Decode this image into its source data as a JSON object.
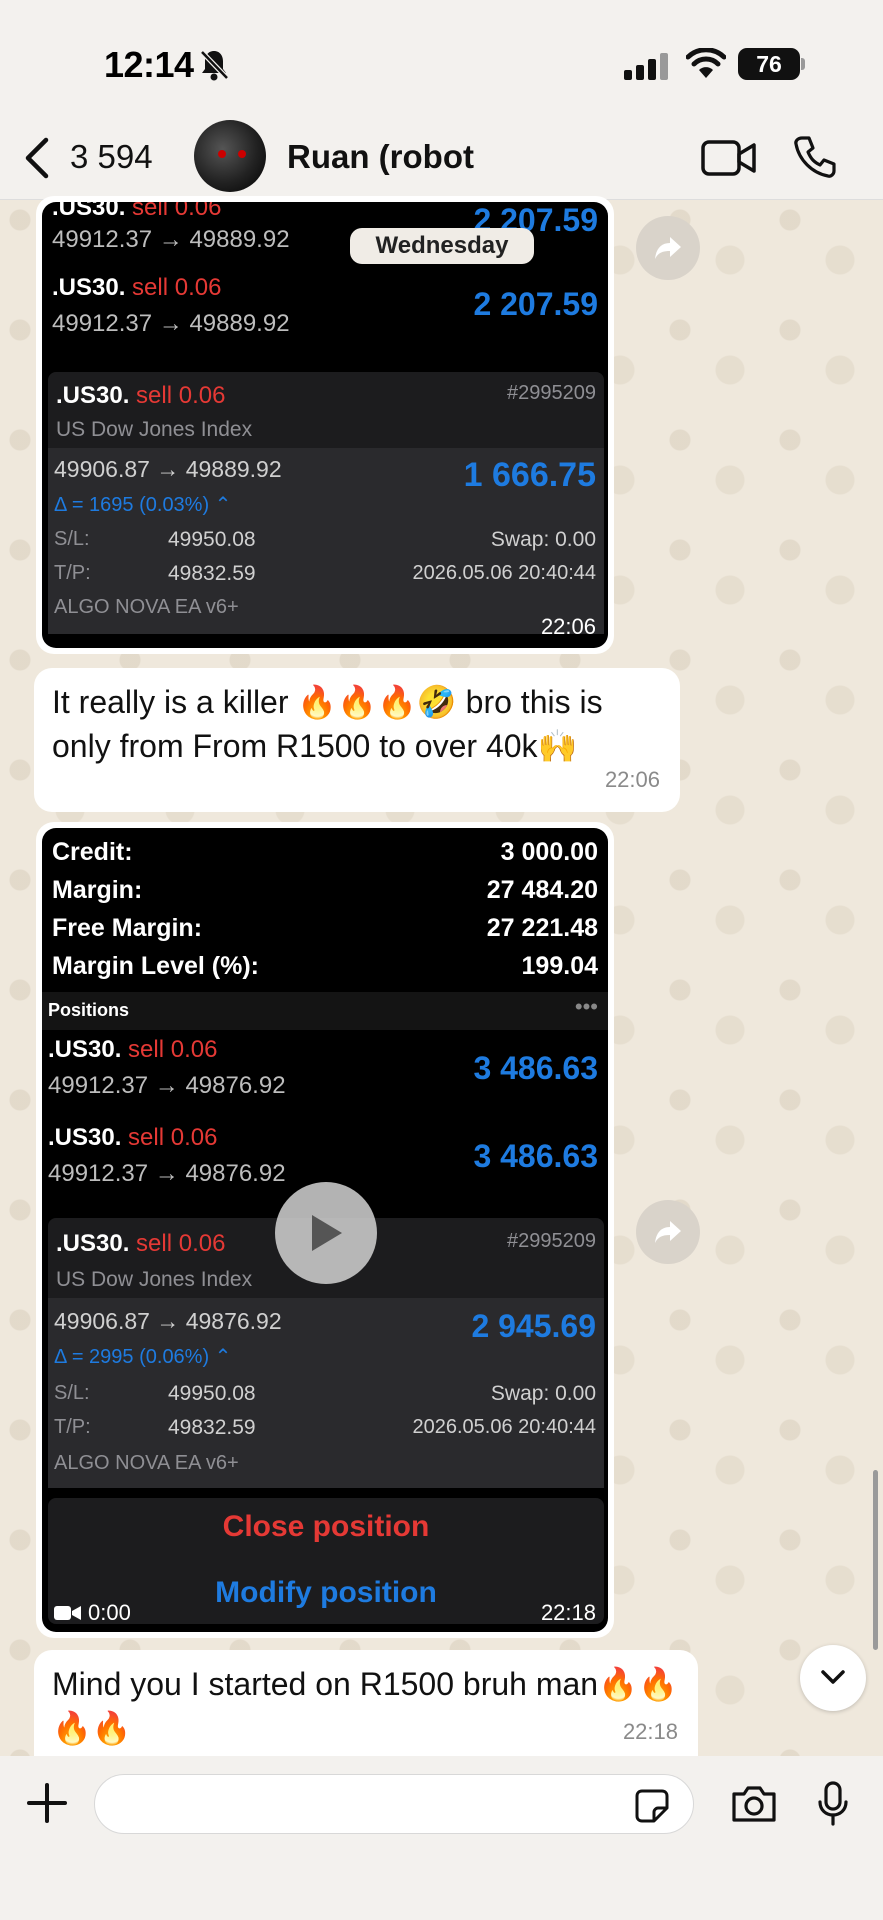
{
  "status_bar": {
    "time": "12:14",
    "battery": "76"
  },
  "header": {
    "back_count": "3 594",
    "contact_name": "Ruan (robot"
  },
  "date_separator": "Wednesday",
  "media1": {
    "rows": [
      {
        "symbol": ".US30.",
        "action": "sell 0.06",
        "prices": "49912.37 → 49889.92",
        "value": "2 207.59"
      },
      {
        "symbol": ".US30.",
        "action": "sell 0.06",
        "prices": "49912.37 → 49889.92",
        "value": "2 207.59"
      }
    ],
    "card": {
      "symbol": ".US30.",
      "action": "sell 0.06",
      "ticket": "#2995209",
      "name": "US Dow Jones Index",
      "prices": "49906.87 → 49889.92",
      "value": "1 666.75",
      "delta": "Δ = 1695 (0.03%) ⌃",
      "sl_label": "S/L:",
      "sl": "49950.08",
      "tp_label": "T/P:",
      "tp": "49832.59",
      "swap": "Swap:  0.00",
      "date": "2026.05.06 20:40:44",
      "comment": "ALGO NOVA EA v6+"
    },
    "time": "22:06"
  },
  "message1": {
    "text": "It really is a killer 🔥🔥🔥🤣 bro this is only from From R1500 to over 40k🙌",
    "time": "22:06"
  },
  "media2": {
    "account": [
      {
        "label": "Credit:",
        "value": "3 000.00"
      },
      {
        "label": "Margin:",
        "value": "27 484.20"
      },
      {
        "label": "Free Margin:",
        "value": "27 221.48"
      },
      {
        "label": "Margin Level (%):",
        "value": "199.04"
      }
    ],
    "positions_label": "Positions",
    "rows": [
      {
        "symbol": ".US30.",
        "action": "sell 0.06",
        "prices": "49912.37 → 49876.92",
        "value": "3 486.63"
      },
      {
        "symbol": ".US30.",
        "action": "sell 0.06",
        "prices": "49912.37 → 49876.92",
        "value": "3 486.63"
      }
    ],
    "card": {
      "symbol": ".US30.",
      "action": "sell 0.06",
      "ticket": "#2995209",
      "name": "US Dow Jones Index",
      "prices": "49906.87 → 49876.92",
      "value": "2 945.69",
      "delta": "Δ = 2995 (0.06%) ⌃",
      "sl_label": "S/L:",
      "sl": "49950.08",
      "tp_label": "T/P:",
      "tp": "49832.59",
      "swap": "Swap:  0.00",
      "date": "2026.05.06 20:40:44",
      "comment": "ALGO NOVA EA v6+"
    },
    "close_position": "Close position",
    "modify_position": "Modify position",
    "video_duration": "0:00",
    "time": "22:18"
  },
  "message2": {
    "text": "Mind you I started on R1500 bruh man🔥🔥🔥🔥",
    "time": "22:18"
  },
  "input": {
    "placeholder": ""
  }
}
